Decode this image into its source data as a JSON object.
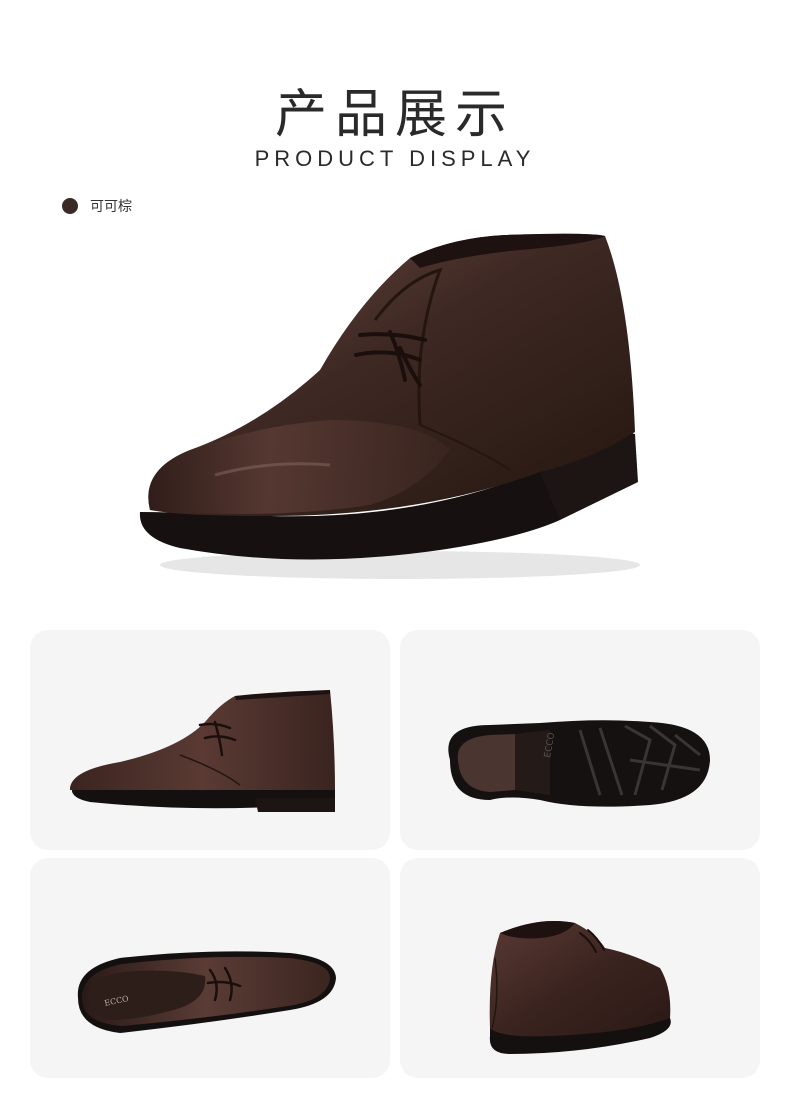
{
  "header": {
    "title_cn": "产品展示",
    "title_en": "PRODUCT DISPLAY"
  },
  "color_option": {
    "label": "可可棕",
    "swatch_color": "#3a2a26"
  },
  "images": {
    "hero": "shoe-hero-three-quarter",
    "views": [
      "shoe-side-view",
      "shoe-sole-view",
      "shoe-top-view",
      "shoe-rear-view"
    ]
  },
  "colors": {
    "leather": "#3b2622",
    "leather_highlight": "#6a4a43",
    "sole": "#1a1413",
    "card_bg": "#f5f5f5"
  }
}
